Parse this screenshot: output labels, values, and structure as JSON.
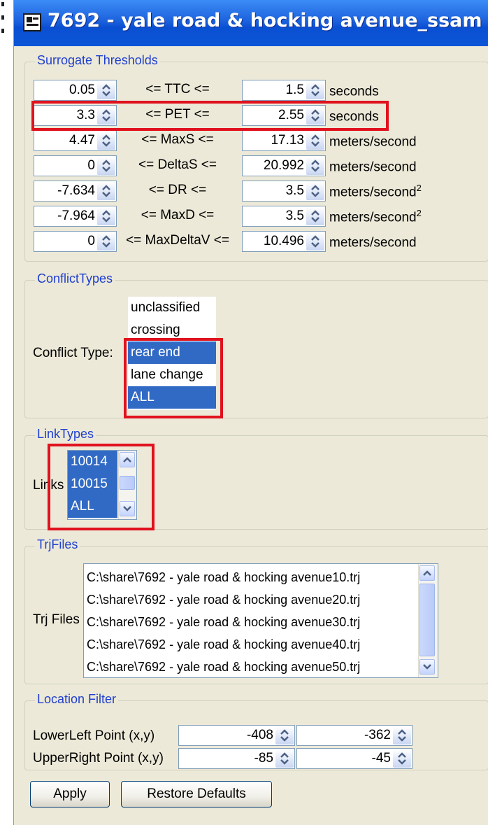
{
  "window": {
    "title": "7692 - yale road & hocking avenue_ssam"
  },
  "surrogate_thresholds": {
    "legend": "Surrogate Thresholds",
    "rows": [
      {
        "lower": "0.05",
        "op": "<= TTC <=",
        "upper": "1.5",
        "unit": "seconds",
        "unit_sup": ""
      },
      {
        "lower": "3.3",
        "op": "<= PET <=",
        "upper": "2.55",
        "unit": "seconds",
        "unit_sup": ""
      },
      {
        "lower": "4.47",
        "op": "<= MaxS <=",
        "upper": "17.13",
        "unit": "meters/second",
        "unit_sup": ""
      },
      {
        "lower": "0",
        "op": "<= DeltaS <=",
        "upper": "20.992",
        "unit": "meters/second",
        "unit_sup": ""
      },
      {
        "lower": "-7.634",
        "op": "<= DR <=",
        "upper": "3.5",
        "unit": "meters/second",
        "unit_sup": "2"
      },
      {
        "lower": "-7.964",
        "op": "<= MaxD <=",
        "upper": "3.5",
        "unit": "meters/second",
        "unit_sup": "2"
      },
      {
        "lower": "0",
        "op": "<= MaxDeltaV <=",
        "upper": "10.496",
        "unit": "meters/second",
        "unit_sup": ""
      }
    ]
  },
  "conflict_types": {
    "legend": "ConflictTypes",
    "label": "Conflict Type:",
    "items": [
      {
        "label": "unclassified",
        "selected": false
      },
      {
        "label": "crossing",
        "selected": false
      },
      {
        "label": "rear end",
        "selected": true
      },
      {
        "label": "lane change",
        "selected": false
      },
      {
        "label": "ALL",
        "selected": true
      }
    ]
  },
  "link_types": {
    "legend": "LinkTypes",
    "label": "Links",
    "items": [
      {
        "label": "10014",
        "selected": true
      },
      {
        "label": "10015",
        "selected": true
      },
      {
        "label": "ALL",
        "selected": true
      }
    ]
  },
  "trj_files": {
    "legend": "TrjFiles",
    "label": "Trj Files",
    "items": [
      "C:\\share\\7692 - yale road & hocking avenue10.trj",
      "C:\\share\\7692 - yale road & hocking avenue20.trj",
      "C:\\share\\7692 - yale road & hocking avenue30.trj",
      "C:\\share\\7692 - yale road & hocking avenue40.trj",
      "C:\\share\\7692 - yale road & hocking avenue50.trj"
    ]
  },
  "location_filter": {
    "legend": "Location Filter",
    "lower_left": {
      "label": "LowerLeft Point (x,y)",
      "x": "-408",
      "y": "-362"
    },
    "upper_right": {
      "label": "UpperRight Point (x,y)",
      "x": "-85",
      "y": "-45"
    }
  },
  "buttons": {
    "apply": "Apply",
    "restore": "Restore Defaults"
  },
  "colors": {
    "highlight_box": "#e0121e",
    "selection": "#316ac5",
    "titlebar": "#0a4fd2",
    "legend_text": "#1f3fd0"
  }
}
